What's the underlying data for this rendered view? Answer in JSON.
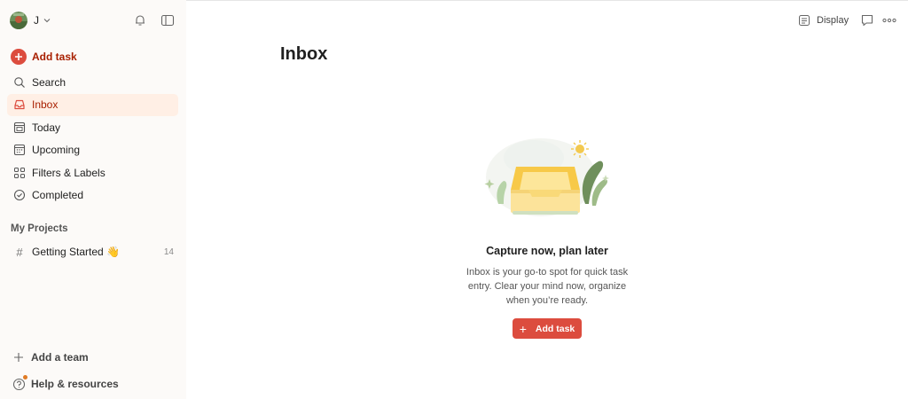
{
  "user": {
    "name": "J"
  },
  "sidebar": {
    "add_task_label": "Add task",
    "items": [
      {
        "label": "Search",
        "icon": "search-icon"
      },
      {
        "label": "Inbox",
        "icon": "inbox-icon",
        "active": true
      },
      {
        "label": "Today",
        "icon": "today-calendar-icon"
      },
      {
        "label": "Upcoming",
        "icon": "upcoming-calendar-icon"
      },
      {
        "label": "Filters & Labels",
        "icon": "filters-grid-icon"
      },
      {
        "label": "Completed",
        "icon": "check-circle-icon"
      }
    ],
    "projects_title": "My Projects",
    "projects": [
      {
        "label": "Getting Started 👋",
        "count": "14"
      }
    ],
    "add_team_label": "Add a team",
    "help_label": "Help & resources"
  },
  "header": {
    "display_label": "Display"
  },
  "main": {
    "title": "Inbox",
    "empty_title": "Capture now, plan later",
    "empty_desc_lines": [
      "Inbox is your go-to spot for quick task",
      "entry. Clear your mind now, organize",
      "when you’re ready."
    ],
    "add_task_button": "Add task"
  },
  "colors": {
    "accent": "#dc4c3e",
    "accent_text": "#a81f00",
    "active_bg": "#ffefe5",
    "sidebar_bg": "#fcfaf8"
  }
}
